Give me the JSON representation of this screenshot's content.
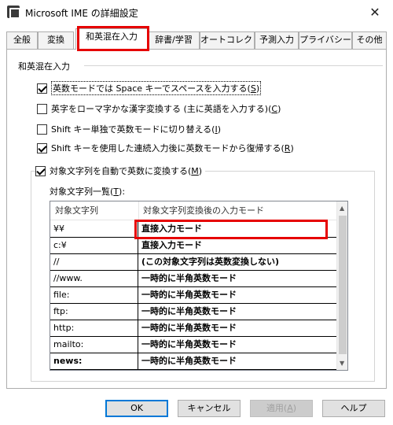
{
  "window": {
    "title": "Microsoft IME の詳細設定",
    "close_glyph": "✕"
  },
  "tabs": [
    {
      "label": "全般"
    },
    {
      "label": "変換"
    },
    {
      "label": "和英混在入力"
    },
    {
      "label": "辞書/学習"
    },
    {
      "label": "オートコレクト"
    },
    {
      "label": "予測入力"
    },
    {
      "label": "プライバシー"
    },
    {
      "label": "その他"
    }
  ],
  "group": {
    "label": "和英混在入力"
  },
  "options": [
    {
      "label": "英数モードでは Space キーでスペースを入力する(",
      "key": "S",
      "checked": true
    },
    {
      "label": "英字をローマ字かな漢字変換する (主に英語を入力する)(",
      "key": "C",
      "checked": false
    },
    {
      "label": "Shift キー単独で英数モードに切り替える(",
      "key": "I",
      "checked": false
    },
    {
      "label": "Shift キーを使用した連続入力後に英数モードから復帰する(",
      "key": "R",
      "checked": true
    }
  ],
  "auto_convert": {
    "label": "対象文字列を自動で英数に変換する(",
    "key": "M",
    "checked": true
  },
  "list_label": {
    "text": "対象文字列一覧(",
    "key": "T",
    "suffix": "):"
  },
  "table": {
    "headers": [
      "対象文字列",
      "対象文字列変換後の入力モード"
    ],
    "rows": [
      {
        "target": "¥¥",
        "mode": "直接入力モード"
      },
      {
        "target": "c:¥",
        "mode": "直接入力モード"
      },
      {
        "target": "//",
        "mode": "(この対象文字列は英数変換しない)"
      },
      {
        "target": "//www.",
        "mode": "一時的に半角英数モード"
      },
      {
        "target": "file:",
        "mode": "一時的に半角英数モード"
      },
      {
        "target": "ftp:",
        "mode": "一時的に半角英数モード"
      },
      {
        "target": "http:",
        "mode": "一時的に半角英数モード"
      },
      {
        "target": "mailto:",
        "mode": "一時的に半角英数モード"
      },
      {
        "target": "news:",
        "mode": "一時的に半角英数モード"
      }
    ]
  },
  "buttons": {
    "ok": "OK",
    "cancel": "キャンセル",
    "apply": "適用(",
    "apply_key": "A",
    "help": "ヘルプ"
  },
  "colors": {
    "highlight": "#e60000",
    "focus": "#0078d7"
  }
}
